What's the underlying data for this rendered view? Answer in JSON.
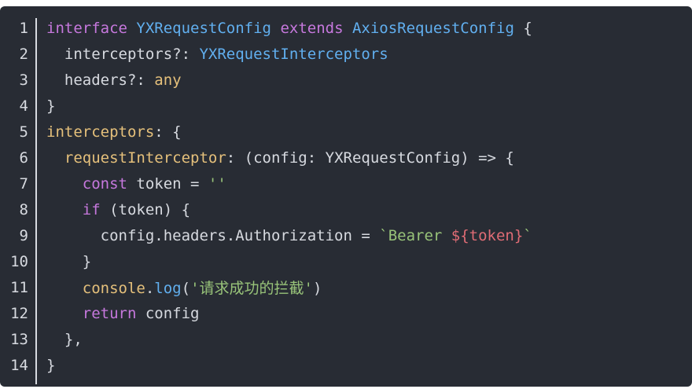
{
  "code": {
    "lines": [
      {
        "num": "1",
        "tokens": [
          [
            "kw",
            "interface"
          ],
          [
            "pl",
            " "
          ],
          [
            "ty",
            "YXRequestConfig"
          ],
          [
            "pl",
            " "
          ],
          [
            "kw",
            "extends"
          ],
          [
            "pl",
            " "
          ],
          [
            "ty",
            "AxiosRequestConfig"
          ],
          [
            "pl",
            " {"
          ]
        ]
      },
      {
        "num": "2",
        "tokens": [
          [
            "pl",
            "  interceptors?: "
          ],
          [
            "ty",
            "YXRequestInterceptors"
          ]
        ]
      },
      {
        "num": "3",
        "tokens": [
          [
            "pl",
            "  headers?: "
          ],
          [
            "pr",
            "any"
          ]
        ]
      },
      {
        "num": "4",
        "tokens": [
          [
            "pl",
            "}"
          ]
        ]
      },
      {
        "num": "5",
        "tokens": [
          [
            "pr",
            "interceptors"
          ],
          [
            "pl",
            ": {"
          ]
        ]
      },
      {
        "num": "6",
        "tokens": [
          [
            "pl",
            "  "
          ],
          [
            "pr",
            "requestInterceptor"
          ],
          [
            "pl",
            ": (config: YXRequestConfig) => {"
          ]
        ]
      },
      {
        "num": "7",
        "tokens": [
          [
            "pl",
            "    "
          ],
          [
            "kw",
            "const"
          ],
          [
            "pl",
            " token = "
          ],
          [
            "st",
            "''"
          ]
        ]
      },
      {
        "num": "8",
        "tokens": [
          [
            "pl",
            "    "
          ],
          [
            "kw",
            "if"
          ],
          [
            "pl",
            " (token) {"
          ]
        ]
      },
      {
        "num": "9",
        "tokens": [
          [
            "pl",
            "      config.headers.Authorization = "
          ],
          [
            "st",
            "`Bearer "
          ],
          [
            "tp",
            "${token}"
          ],
          [
            "st",
            "`"
          ]
        ]
      },
      {
        "num": "10",
        "tokens": [
          [
            "pl",
            "    }"
          ]
        ]
      },
      {
        "num": "11",
        "tokens": [
          [
            "pl",
            "    "
          ],
          [
            "pr",
            "console"
          ],
          [
            "pl",
            "."
          ],
          [
            "fn",
            "log"
          ],
          [
            "pl",
            "("
          ],
          [
            "st",
            "'请求成功的拦截'"
          ],
          [
            "pl",
            ")"
          ]
        ]
      },
      {
        "num": "12",
        "tokens": [
          [
            "pl",
            "    "
          ],
          [
            "kw",
            "return"
          ],
          [
            "pl",
            " config"
          ]
        ]
      },
      {
        "num": "13",
        "tokens": [
          [
            "pl",
            "  },"
          ]
        ]
      },
      {
        "num": "14",
        "tokens": [
          [
            "pl",
            "}"
          ]
        ]
      }
    ]
  },
  "colors": {
    "background": "#282c34",
    "plain": "#d7dae0",
    "keyword": "#c678dd",
    "type": "#61afef",
    "property": "#e5c07b",
    "string": "#98c379",
    "template": "#e06c75"
  }
}
